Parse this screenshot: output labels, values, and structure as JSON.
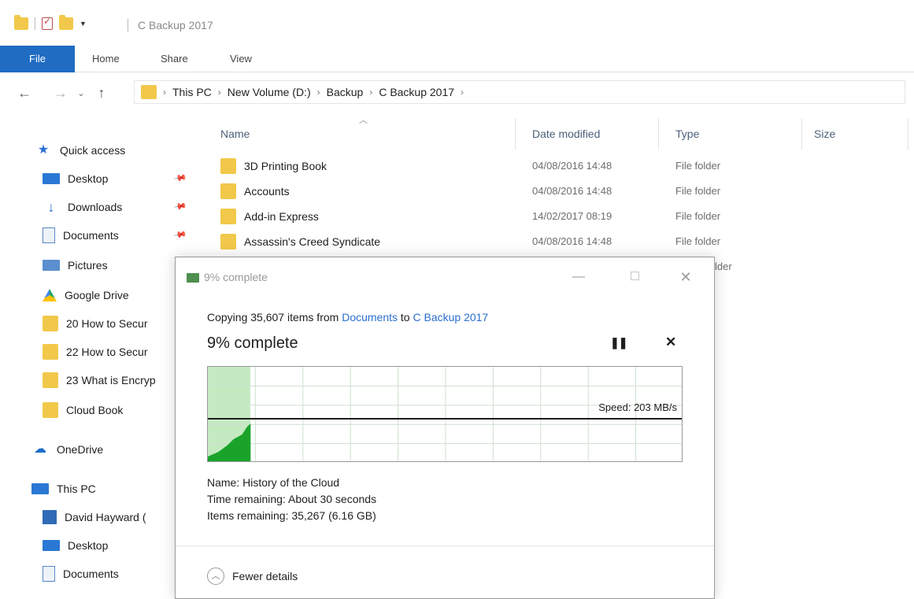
{
  "window": {
    "title": "C Backup 2017"
  },
  "ribbon": {
    "tabs": [
      "File",
      "Home",
      "Share",
      "View"
    ]
  },
  "address": {
    "crumbs": [
      "This PC",
      "New Volume (D:)",
      "Backup",
      "C Backup 2017"
    ]
  },
  "navpane": {
    "quick_access": "Quick access",
    "pinned": [
      {
        "label": "Desktop",
        "icon": "desktop-icon"
      },
      {
        "label": "Downloads",
        "icon": "download-arrow-icon"
      },
      {
        "label": "Documents",
        "icon": "document-icon"
      }
    ],
    "items": [
      {
        "label": "Pictures",
        "icon": "pictures-icon"
      },
      {
        "label": "Google Drive",
        "icon": "google-drive-icon"
      },
      {
        "label": "20 How to Secur",
        "icon": "folder-icon"
      },
      {
        "label": "22 How to Secur",
        "icon": "folder-icon"
      },
      {
        "label": "23 What is Encryp",
        "icon": "folder-icon"
      },
      {
        "label": "Cloud Book",
        "icon": "folder-icon"
      }
    ],
    "onedrive": "OneDrive",
    "this_pc": "This PC",
    "pc_items": [
      {
        "label": "David Hayward (",
        "icon": "user-folder-icon"
      },
      {
        "label": "Desktop",
        "icon": "desktop-icon"
      },
      {
        "label": "Documents",
        "icon": "document-icon"
      }
    ]
  },
  "filelist": {
    "columns": {
      "name": "Name",
      "date": "Date modified",
      "type": "Type",
      "size": "Size"
    },
    "rows": [
      {
        "name": "3D Printing Book",
        "date": "04/08/2016 14:48",
        "type": "File folder"
      },
      {
        "name": "Accounts",
        "date": "04/08/2016 14:48",
        "type": "File folder"
      },
      {
        "name": "Add-in Express",
        "date": "14/02/2017 08:19",
        "type": "File folder"
      },
      {
        "name": "Assassin's Creed Syndicate",
        "date": "04/08/2016 14:48",
        "type": "File folder"
      }
    ],
    "partial_type": "lder"
  },
  "dialog": {
    "title": "9% complete",
    "copying_prefix": "Copying 35,607 items from ",
    "source": "Documents",
    "to_word": " to ",
    "destination": "C Backup 2017",
    "percent_label": "9% complete",
    "progress_percent": 9,
    "speed_label": "Speed: 203 MB/s",
    "details": {
      "name_label": "Name:",
      "name_value": "History of the Cloud",
      "time_label": "Time remaining:",
      "time_value": "About 30 seconds",
      "items_label": "Items remaining:",
      "items_value": "35,267 (6.16 GB)"
    },
    "fewer_details": "Fewer details",
    "colors": {
      "progress": "#c5eac2",
      "graph_fill": "#1aa32a",
      "link": "#2a6fd0"
    }
  }
}
